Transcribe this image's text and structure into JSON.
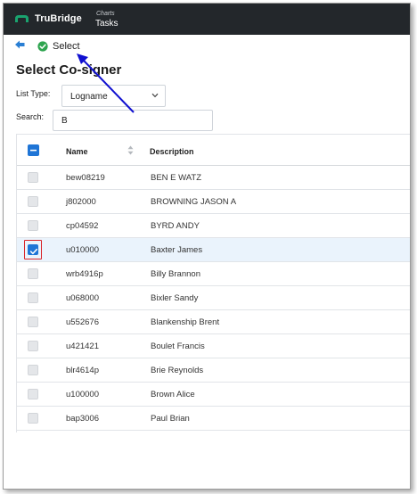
{
  "header": {
    "logo_text": "TruBridge",
    "charts_label": "Charts",
    "tasks_label": "Tasks"
  },
  "toolbar": {
    "back_icon": "back-arrow-icon",
    "select_icon": "green-check-circle-icon",
    "select_label": "Select"
  },
  "page": {
    "title": "Select Co-signer"
  },
  "filters": {
    "list_type_label": "List Type:",
    "list_type_value": "Logname",
    "search_label": "Search:",
    "search_value": "B"
  },
  "table": {
    "columns": [
      "Name",
      "Description"
    ],
    "rows": [
      {
        "name": "bew08219",
        "description": "BEN E WATZ",
        "checked": false
      },
      {
        "name": "j802000",
        "description": "BROWNING JASON A",
        "checked": false
      },
      {
        "name": "cp04592",
        "description": "BYRD ANDY",
        "checked": false
      },
      {
        "name": "u010000",
        "description": "Baxter James",
        "checked": true
      },
      {
        "name": "wrb4916p",
        "description": "Billy Brannon",
        "checked": false
      },
      {
        "name": "u068000",
        "description": "Bixler Sandy",
        "checked": false
      },
      {
        "name": "u552676",
        "description": "Blankenship Brent",
        "checked": false
      },
      {
        "name": "u421421",
        "description": "Boulet Francis",
        "checked": false
      },
      {
        "name": "blr4614p",
        "description": "Brie Reynolds",
        "checked": false
      },
      {
        "name": "u100000",
        "description": "Brown Alice",
        "checked": false
      },
      {
        "name": "bap3006",
        "description": "Paul Brian",
        "checked": false
      }
    ]
  },
  "colors": {
    "header_bg": "#23272b",
    "accent_blue": "#1f75d6",
    "selected_row_bg": "#eaf3fc",
    "annotation_red": "#d9262b",
    "annotation_arrow": "#1010d0",
    "logo_green": "#1aa36f"
  }
}
